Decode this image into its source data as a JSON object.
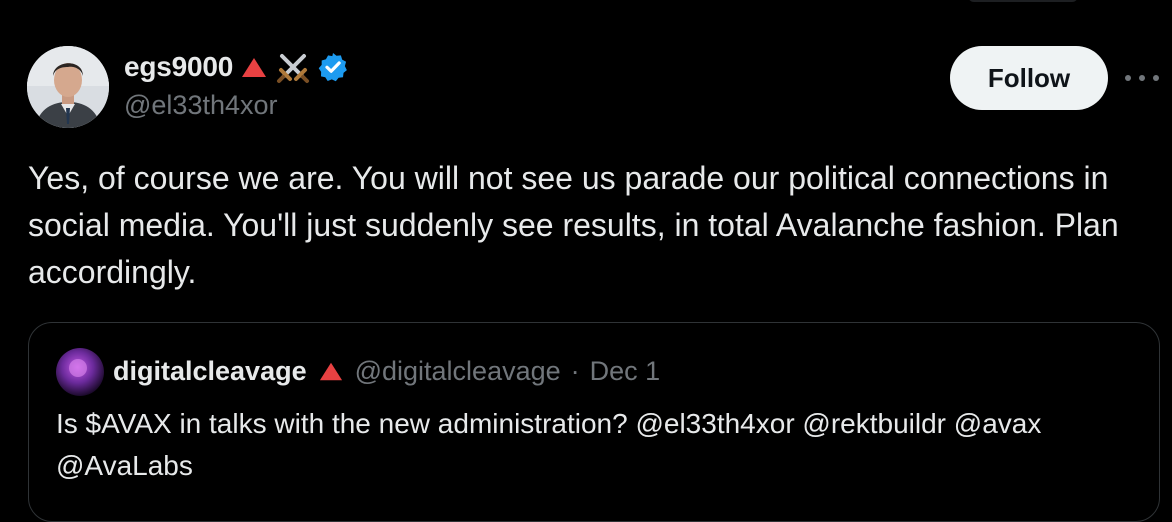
{
  "author": {
    "display_name": "egs9000",
    "handle": "@el33th4xor",
    "badges": [
      "red-triangle-icon",
      "crossed-swords-icon",
      "verified-badge-icon"
    ]
  },
  "actions": {
    "follow_label": "Follow",
    "more_icon": "more-options-icon"
  },
  "tweet": {
    "text": "Yes, of course we are. You will not see us parade our political connections in social media. You'll just suddenly see results, in total Avalanche fashion. Plan accordingly."
  },
  "quoted_tweet": {
    "display_name": "digitalcleavage",
    "handle": "@digitalcleavage",
    "separator": "·",
    "date": "Dec 1",
    "text": "Is $AVAX in talks with the new administration? @el33th4xor @rektbuildr @avax @AvaLabs"
  },
  "colors": {
    "background": "#000000",
    "text_primary": "#e7e9ea",
    "text_secondary": "#71767b",
    "avalanche_red": "#e84142",
    "verified_blue": "#1d9bf0",
    "follow_bg": "#eff3f4",
    "border": "#2f3336"
  }
}
